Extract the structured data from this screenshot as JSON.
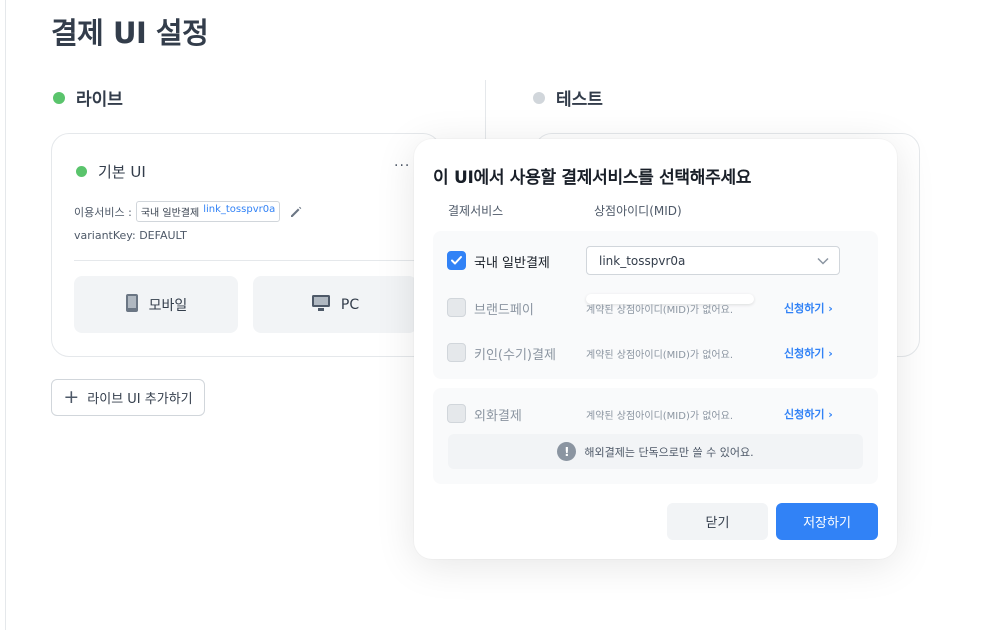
{
  "page": {
    "title": "결제 UI 설정"
  },
  "sections": {
    "live": "라이브",
    "test": "테스트"
  },
  "live_card": {
    "name": "기본 UI",
    "more": "···",
    "service_label": "이용서비스 :",
    "service_tag": "국내 일반결제",
    "service_mid": "link_tosspvr0a",
    "variant": "variantKey: DEFAULT",
    "devices": {
      "mobile": "모바일",
      "pc": "PC"
    }
  },
  "add_live_button": "라이브 UI 추가하기",
  "modal": {
    "title": "이 UI에서 사용할 결제서비스를 선택해주세요",
    "col_service": "결제서비스",
    "col_mid": "상점아이디(MID)",
    "rows": [
      {
        "label": "국내 일반결제",
        "checked": true,
        "mid": "link_tosspvr0a"
      },
      {
        "label": "브랜드페이",
        "checked": false,
        "msg": "계약된 상점아이디(MID)가 없어요.",
        "link": "신청하기 ›"
      },
      {
        "label": "키인(수기)결제",
        "checked": false,
        "msg": "계약된 상점아이디(MID)가 없어요.",
        "link": "신청하기 ›"
      },
      {
        "label": "외화결제",
        "checked": false,
        "msg": "계약된 상점아이디(MID)가 없어요.",
        "link": "신청하기 ›"
      }
    ],
    "info_icon": "!",
    "info": "해외결제는 단독으로만 쓸 수 있어요.",
    "close": "닫기",
    "save": "저장하기"
  },
  "colors": {
    "accent": "#3182f6",
    "live_dot": "#5ac46c",
    "test_dot": "#d1d6db"
  }
}
